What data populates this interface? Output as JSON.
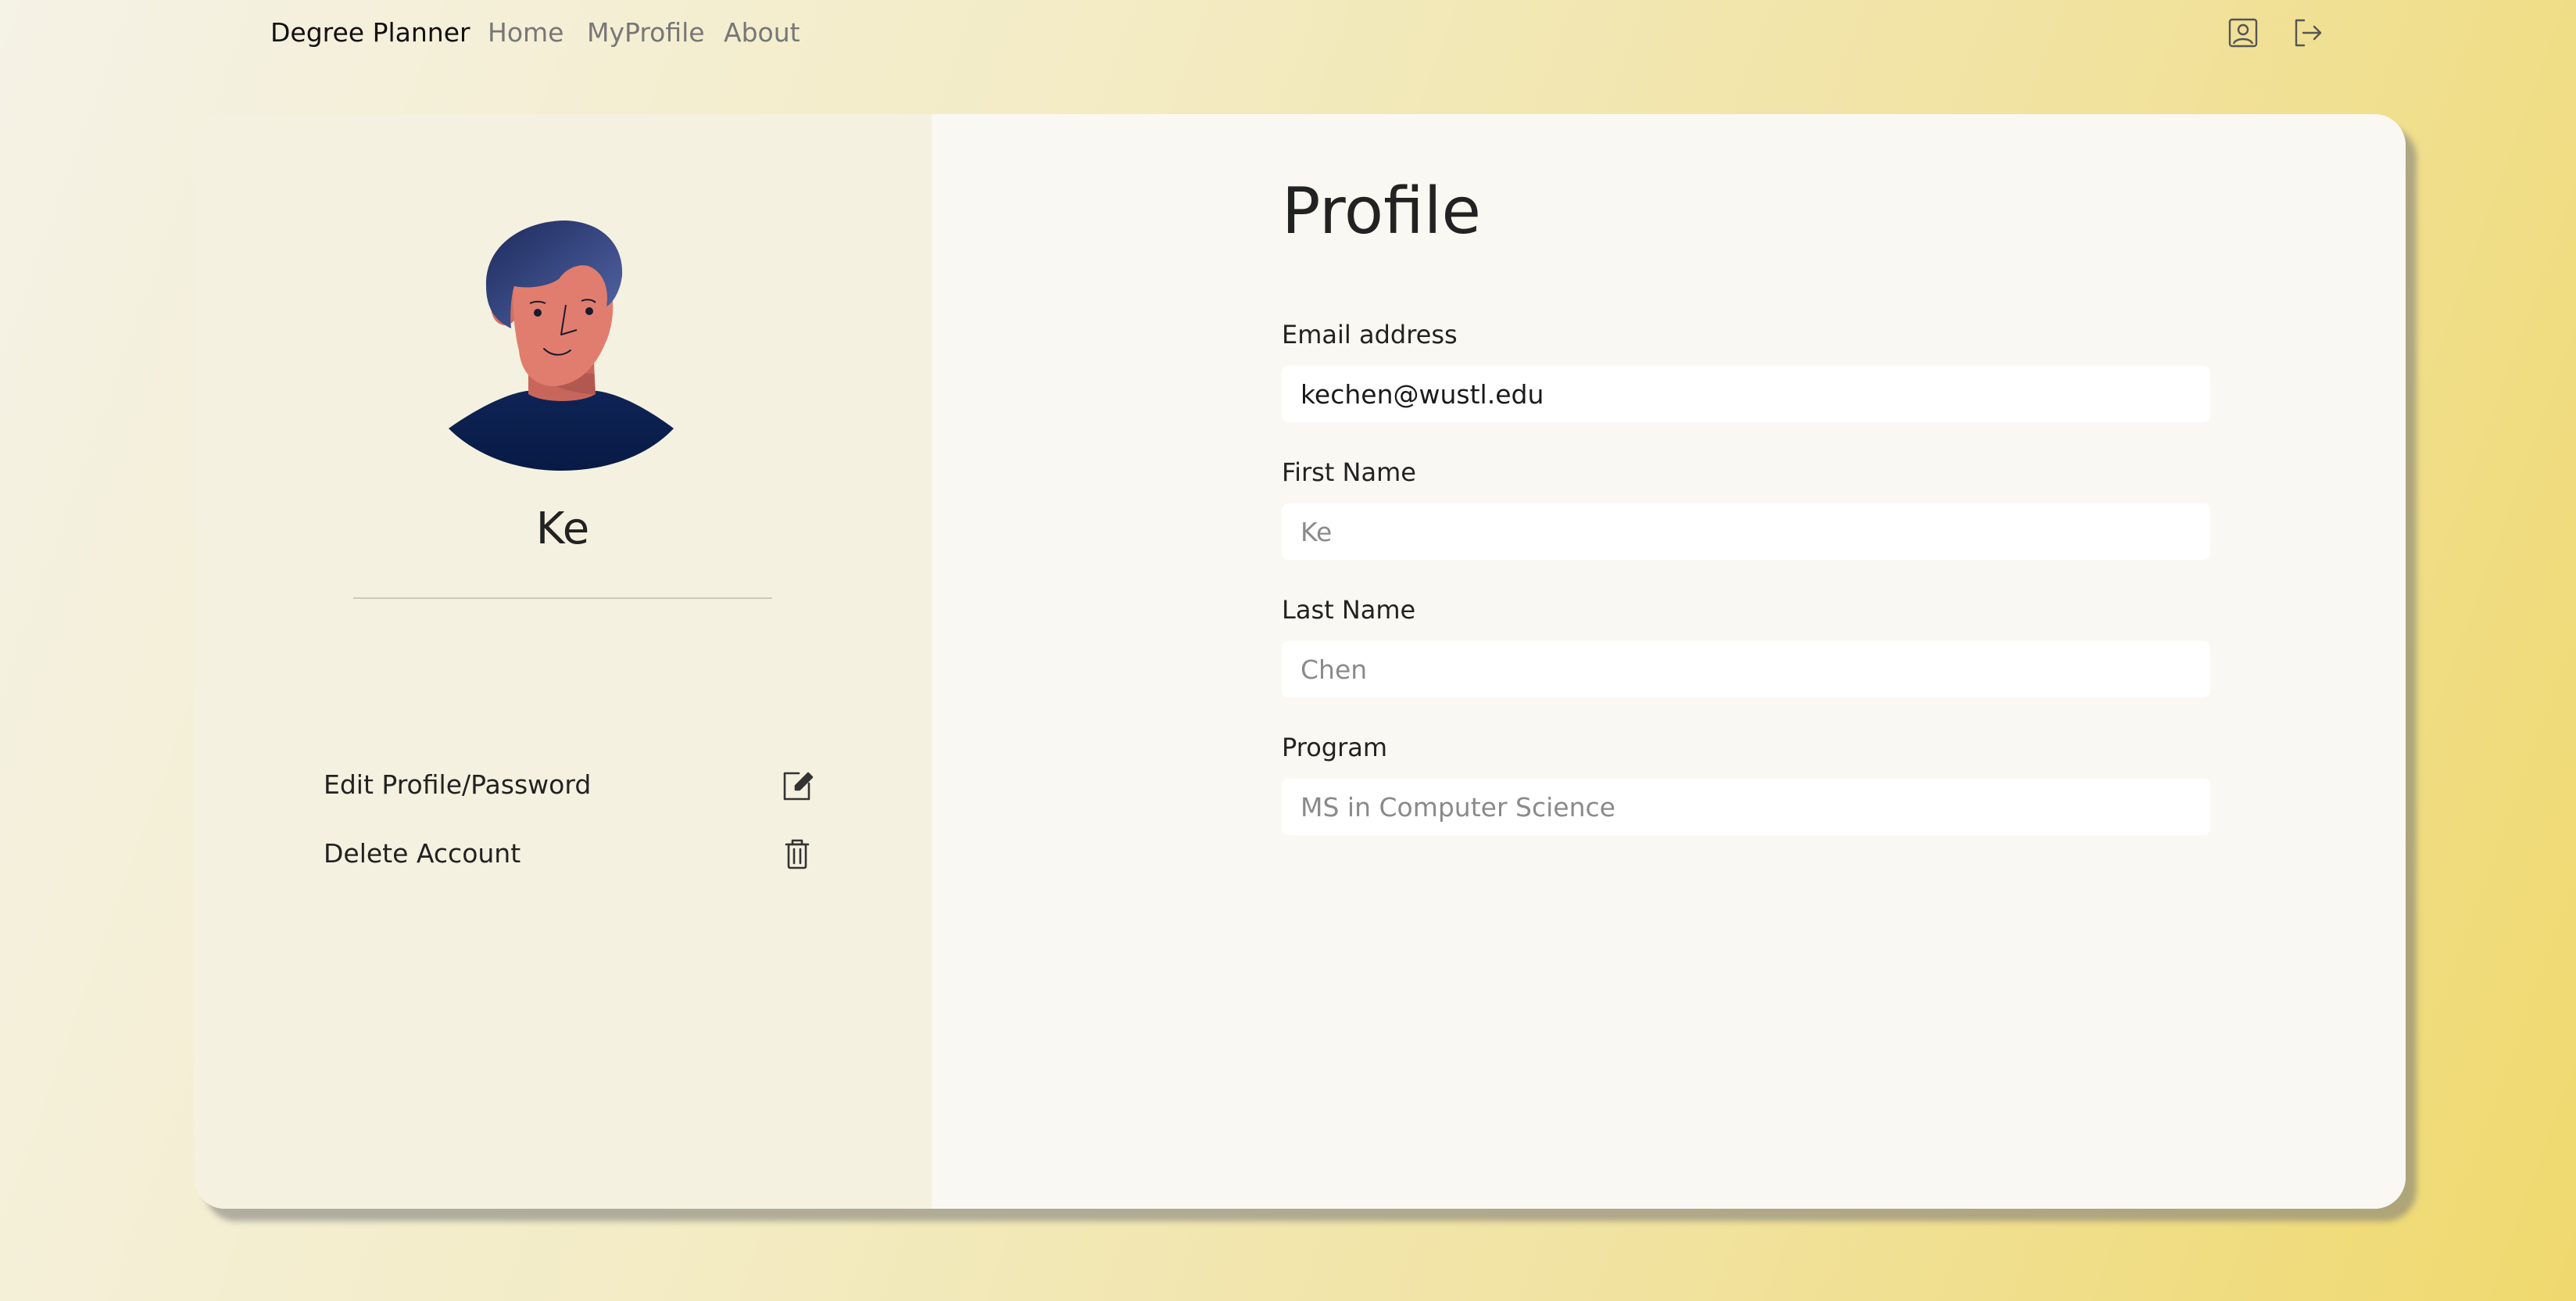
{
  "navbar": {
    "brand": "Degree Planner",
    "links": [
      "Home",
      "MyProfile",
      "About"
    ],
    "icons": [
      "profile-icon",
      "logout-icon"
    ]
  },
  "sidebar": {
    "avatar_icon": "avatar-illustration",
    "user_name": "Ke",
    "items": [
      {
        "label": "Edit Profile/Password",
        "icon": "edit-icon"
      },
      {
        "label": "Delete Account",
        "icon": "trash-icon"
      }
    ]
  },
  "profile": {
    "title": "Profile",
    "fields": [
      {
        "label": "Email address",
        "value": "kechen@wustl.edu",
        "placeholder": ""
      },
      {
        "label": "First Name",
        "value": "",
        "placeholder": "Ke"
      },
      {
        "label": "Last Name",
        "value": "",
        "placeholder": "Chen"
      },
      {
        "label": "Program",
        "value": "",
        "placeholder": "MS in Computer Science"
      }
    ]
  },
  "colors": {
    "background_start": "#f5f2e6",
    "background_end": "#efd96e",
    "left_panel": "#f5f1e0",
    "right_panel": "#faf8f3",
    "avatar_hair": "#3b4f91",
    "avatar_skin": "#e17d6e",
    "avatar_sweater": "#0c2050"
  }
}
